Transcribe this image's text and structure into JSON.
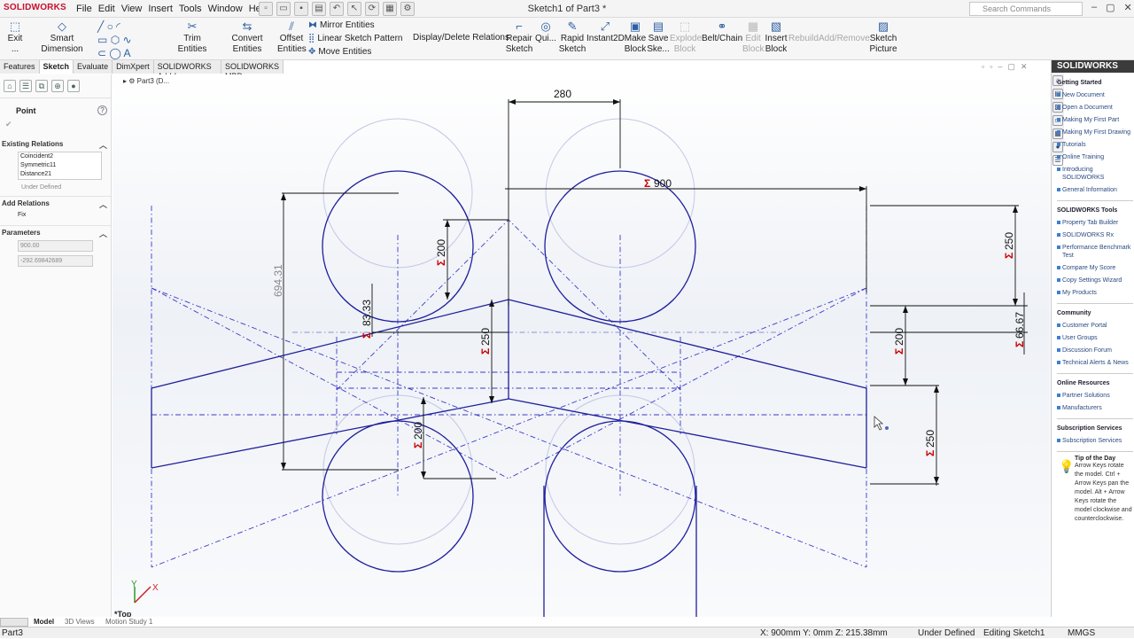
{
  "app": {
    "logo": "SOLIDWORKS",
    "title": "Sketch1 of Part3 *"
  },
  "menu": [
    "File",
    "Edit",
    "View",
    "Insert",
    "Tools",
    "Window",
    "Help"
  ],
  "search": {
    "placeholder": "Search Commands"
  },
  "ribbon": {
    "exit": "Exit ...",
    "smart_dimension": "Smart Dimension",
    "trim": "Trim Entities",
    "convert": "Convert Entities",
    "offset1": "Offset",
    "offset2": "Entities",
    "mirror": "Mirror Entities",
    "linear_pattern": "Linear Sketch Pattern",
    "move": "Move Entities",
    "display_delete": "Display/Delete Relations",
    "repair1": "Repair",
    "repair2": "Sketch",
    "quick": "Qui...",
    "rapid1": "Rapid",
    "rapid2": "Sketch",
    "instant2d": "Instant2D",
    "make1": "Make",
    "make2": "Block",
    "save1": "Save",
    "save2": "Ske...",
    "explode1": "Explode",
    "explode2": "Block",
    "beltchain": "Belt/Chain",
    "edit1": "Edit",
    "edit2": "Block",
    "insert1": "Insert",
    "insert2": "Block",
    "rebuild": "Rebuild",
    "addremove": "Add/Remove",
    "sketchpic1": "Sketch",
    "sketchpic2": "Picture"
  },
  "tabs": [
    "Features",
    "Sketch",
    "Evaluate",
    "DimXpert",
    "SOLIDWORKS Add-Ins",
    "SOLIDWORKS MBD"
  ],
  "tree": {
    "root": "Part3  (D..."
  },
  "property": {
    "title": "Point",
    "existing_relations": "Existing Relations",
    "relations": [
      "Coincident2",
      "Symmetric11",
      "Distance21"
    ],
    "under_defined": "Under Defined",
    "add_relations": "Add Relations",
    "fix": "Fix",
    "parameters": "Parameters",
    "x_value": "900.00",
    "y_value": "-292.69842689"
  },
  "dimensions": {
    "d280": "280",
    "d900": "900",
    "d200a": "200",
    "d8333": "83.33",
    "d250a": "250",
    "d200b": "200",
    "d69431": "694.31",
    "d250b": "250",
    "d6667": "66.67",
    "d200c": "200",
    "d250c": "250"
  },
  "view": {
    "orientation": "*Top",
    "axis_x": "X",
    "axis_y": "Y"
  },
  "taskpane": {
    "header": "SOLIDWORKS",
    "getting_started": "Getting Started",
    "gs_items": [
      "New Document",
      "Open a Document",
      "Making My First Part",
      "Making My First Drawing",
      "Tutorials",
      "Online Training",
      "Introducing SOLIDWORKS",
      "General Information"
    ],
    "tools": "SOLIDWORKS Tools",
    "tools_items": [
      "Property Tab Builder",
      "SOLIDWORKS Rx",
      "Performance Benchmark Test",
      "Compare My Score",
      "Copy Settings Wizard",
      "My Products"
    ],
    "community": "Community",
    "community_items": [
      "Customer Portal",
      "User Groups",
      "Discussion Forum",
      "Technical Alerts & News"
    ],
    "online": "Online Resources",
    "online_items": [
      "Partner Solutions",
      "Manufacturers"
    ],
    "subscription": "Subscription Services",
    "subscription_items": [
      "Subscription Services"
    ],
    "tip_title": "Tip of the Day",
    "tip_text": "Arrow Keys rotate the model. Ctrl + Arrow Keys pan the model. Alt + Arrow Keys rotate the model clockwise and counterclockwise."
  },
  "bottom_tabs": [
    "Model",
    "3D Views",
    "Motion Study 1"
  ],
  "status": {
    "doc": "Part3",
    "coords": "X: 900mm Y: 0mm Z: 215.38mm",
    "state": "Under Defined",
    "editing": "Editing Sketch1",
    "units": "MMGS"
  },
  "colors": {
    "sketch": "#1f1f9c",
    "construction": "#3a3ac8",
    "ghost": "#b8bde0",
    "dim": "#111",
    "sigma": "#cc0000"
  }
}
